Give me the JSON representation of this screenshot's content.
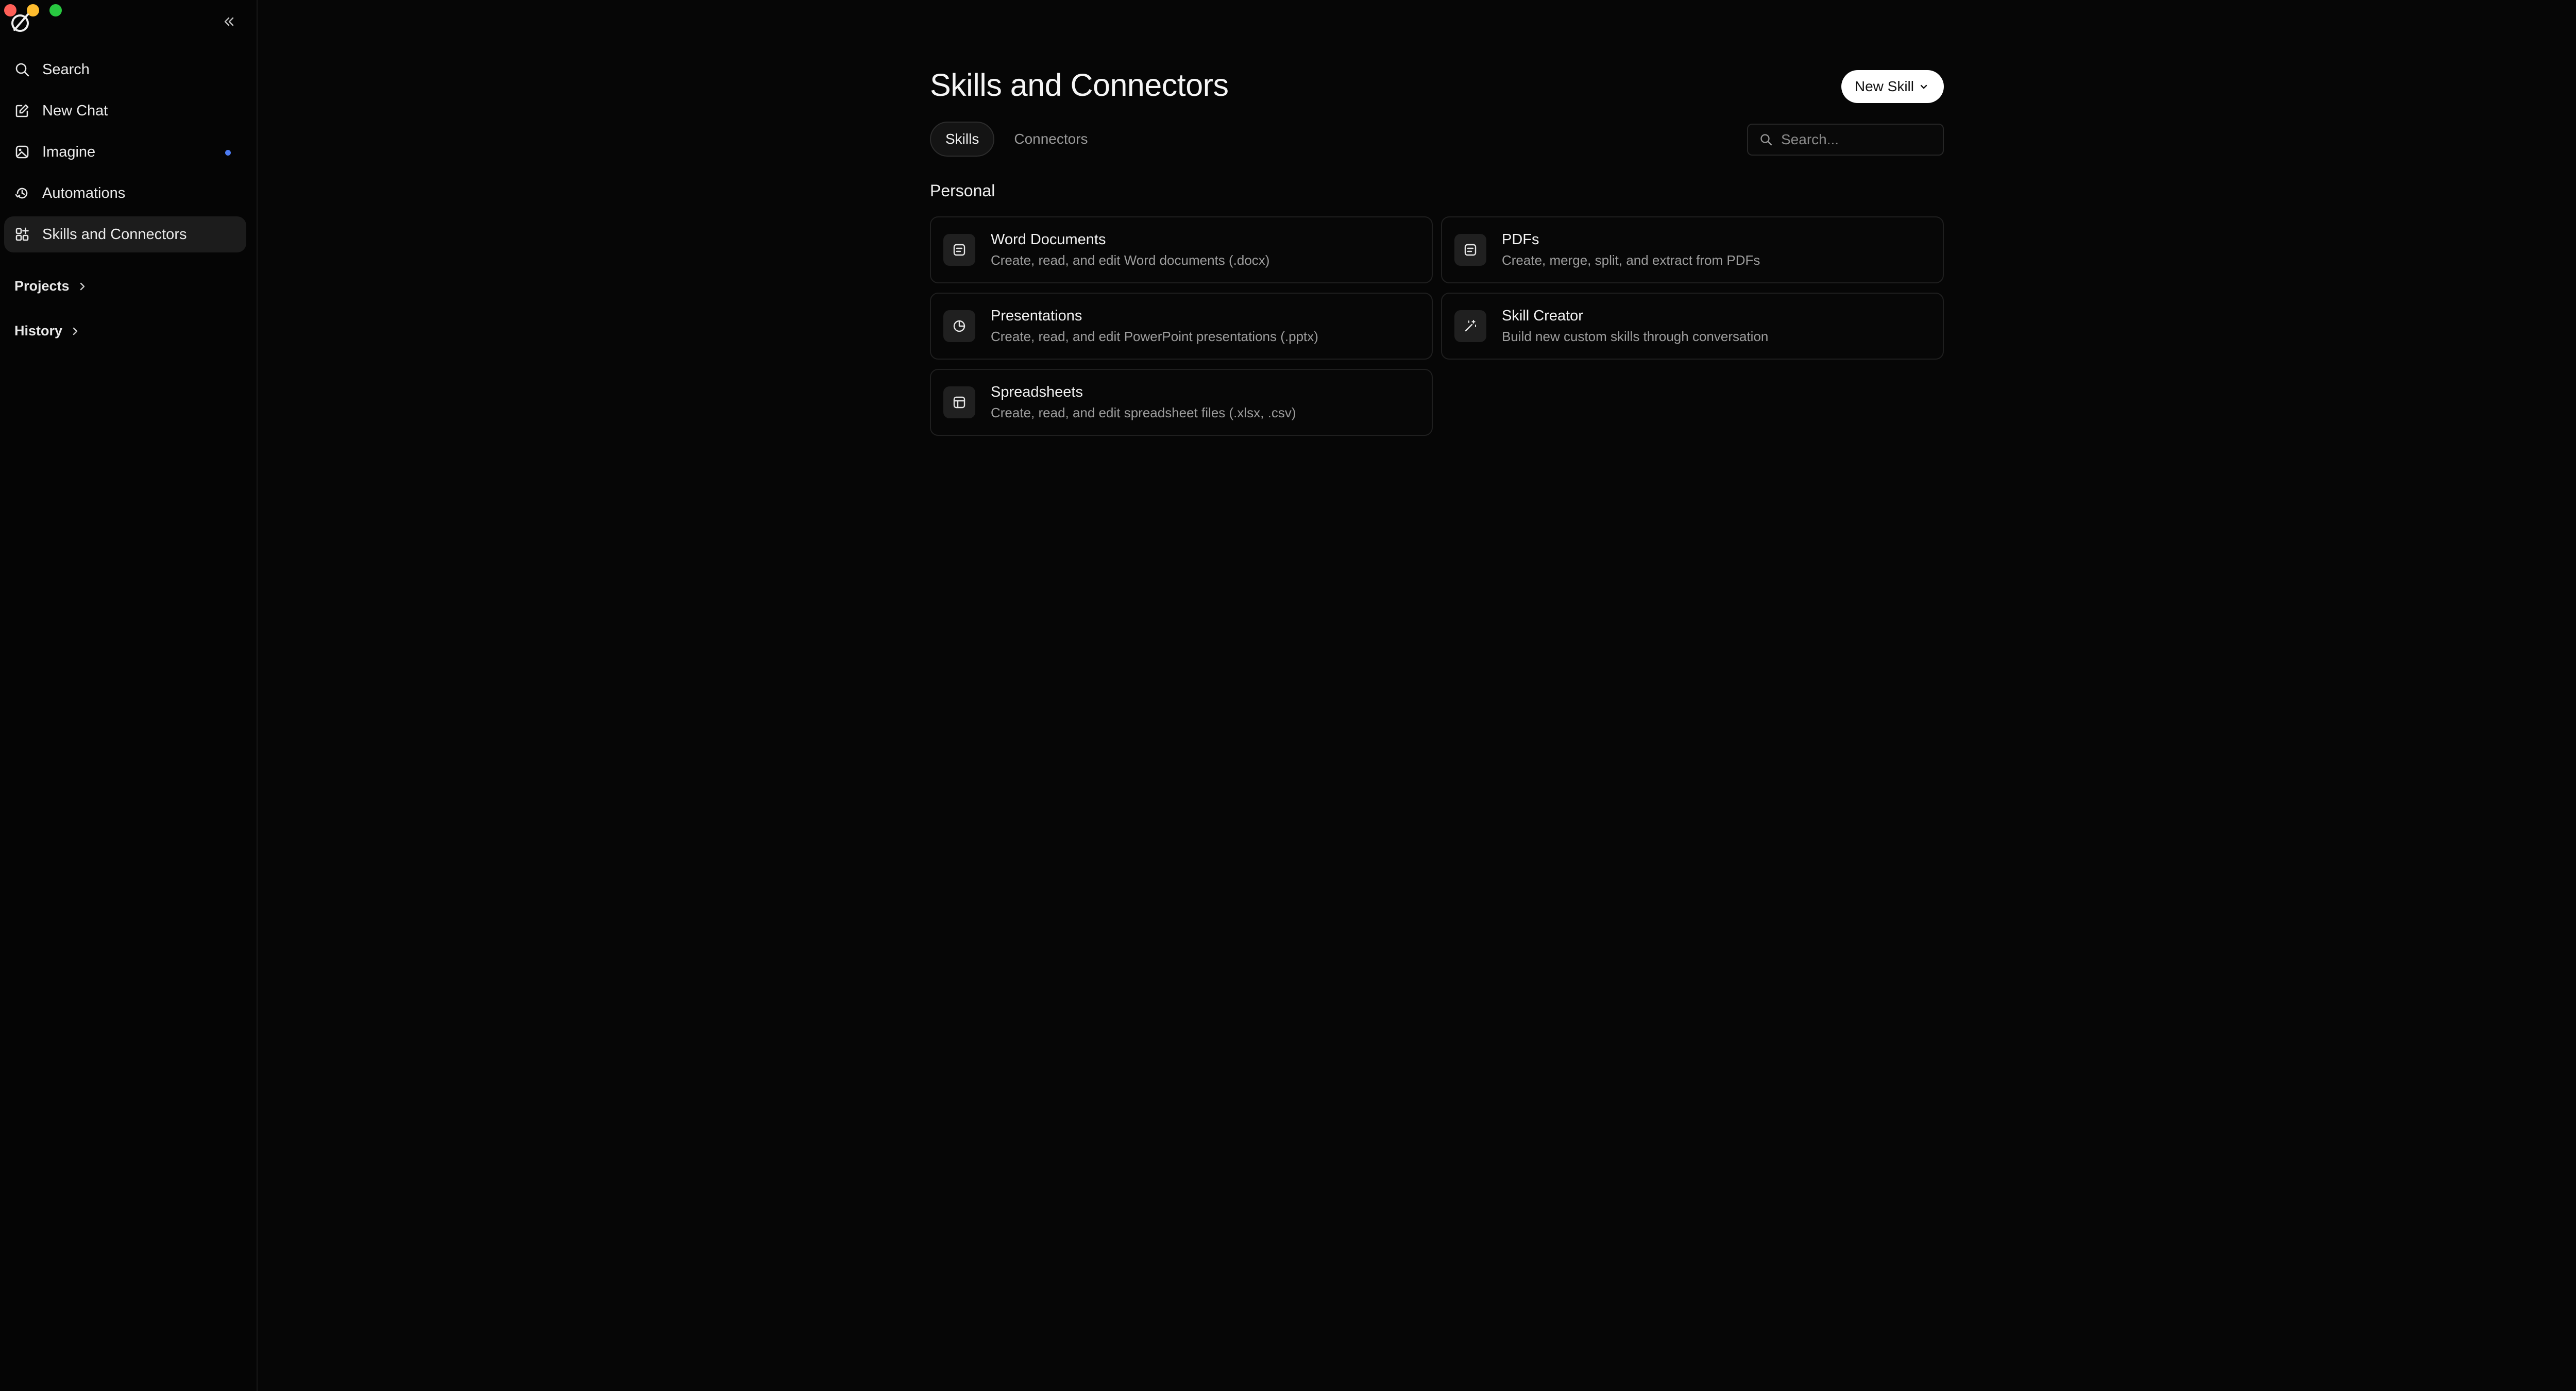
{
  "window": {
    "traffic_lights": {
      "close": "#ff5f57",
      "minimize": "#febc2e",
      "zoom": "#28c840"
    }
  },
  "sidebar": {
    "collapse_icon": "double-chevron-left-icon",
    "items": [
      {
        "label": "Search",
        "icon": "search-icon"
      },
      {
        "label": "New Chat",
        "icon": "edit-icon"
      },
      {
        "label": "Imagine",
        "icon": "image-icon",
        "has_indicator": true
      },
      {
        "label": "Automations",
        "icon": "automation-icon"
      },
      {
        "label": "Skills and Connectors",
        "icon": "skills-icon",
        "active": true
      }
    ],
    "projects_label": "Projects",
    "history_label": "History"
  },
  "main": {
    "title": "Skills and Connectors",
    "new_skill_label": "New Skill",
    "tabs": [
      {
        "label": "Skills",
        "active": true
      },
      {
        "label": "Connectors",
        "active": false
      }
    ],
    "search_placeholder": "Search...",
    "section_heading": "Personal",
    "skills": [
      {
        "title": "Word Documents",
        "description": "Create, read, and edit Word documents (.docx)",
        "icon": "document-icon"
      },
      {
        "title": "PDFs",
        "description": "Create, merge, split, and extract from PDFs",
        "icon": "pdf-icon"
      },
      {
        "title": "Presentations",
        "description": "Create, read, and edit PowerPoint presentations (.pptx)",
        "icon": "pie-chart-icon"
      },
      {
        "title": "Skill Creator",
        "description": "Build new custom skills through conversation",
        "icon": "magic-wand-icon"
      },
      {
        "title": "Spreadsheets",
        "description": "Create, read, and edit spreadsheet files (.xlsx, .csv)",
        "icon": "table-icon"
      }
    ]
  },
  "colors": {
    "background": "#060606",
    "accent_dot": "#4d7cf3",
    "active_bg": "#1c1c1c"
  }
}
